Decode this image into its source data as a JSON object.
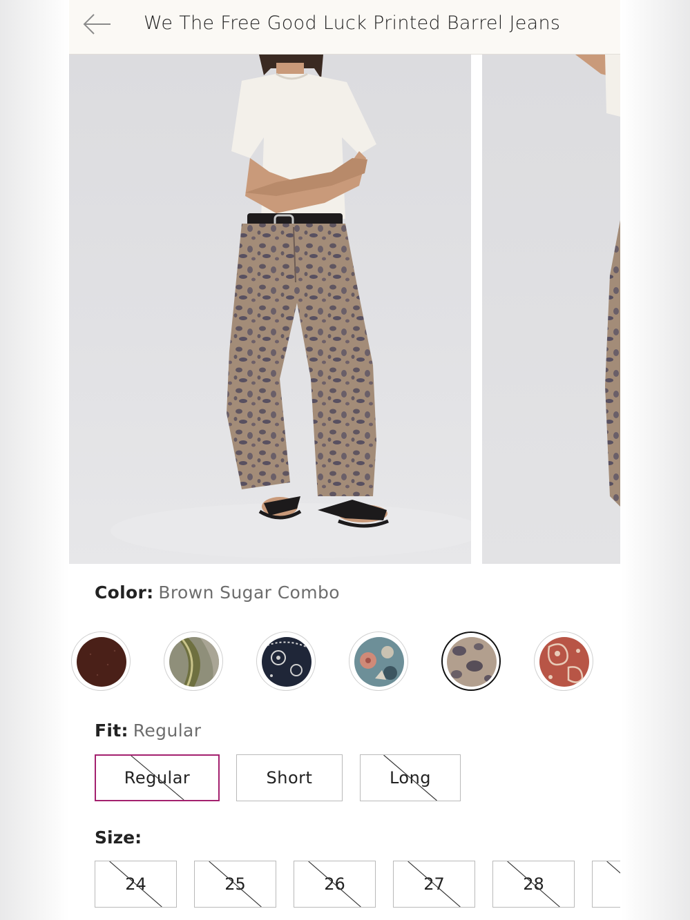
{
  "header": {
    "title": "We The Free Good Luck Printed Barrel Jeans",
    "back_icon": "arrow-left-icon"
  },
  "gallery": {
    "images": [
      {
        "alt": "model-front-view"
      },
      {
        "alt": "model-side-view"
      }
    ]
  },
  "color": {
    "label": "Color:",
    "selected_value": "Brown Sugar Combo",
    "swatches": [
      {
        "name": "dark-brown",
        "color": "#4a2018"
      },
      {
        "name": "green-stripe",
        "color": "#6b6a48"
      },
      {
        "name": "navy-paisley",
        "color": "#1f2638"
      },
      {
        "name": "blue-floral",
        "color": "#6d8f98"
      },
      {
        "name": "brown-sugar-combo",
        "color": "#9a8878",
        "selected": true
      },
      {
        "name": "red-paisley",
        "color": "#b85546"
      }
    ]
  },
  "fit": {
    "label": "Fit:",
    "selected_value": "Regular",
    "options": [
      {
        "label": "Regular",
        "selected": true,
        "unavailable": true
      },
      {
        "label": "Short",
        "selected": false,
        "unavailable": false
      },
      {
        "label": "Long",
        "selected": false,
        "unavailable": true
      }
    ]
  },
  "size": {
    "label": "Size:",
    "options": [
      {
        "label": "24",
        "unavailable": true
      },
      {
        "label": "25",
        "unavailable": true
      },
      {
        "label": "26",
        "unavailable": true
      },
      {
        "label": "27",
        "unavailable": true
      },
      {
        "label": "28",
        "unavailable": true
      },
      {
        "label": "",
        "unavailable": true
      }
    ]
  },
  "colors": {
    "selected_fit_border": "#a3206e",
    "header_bg": "#fbf9f5"
  }
}
